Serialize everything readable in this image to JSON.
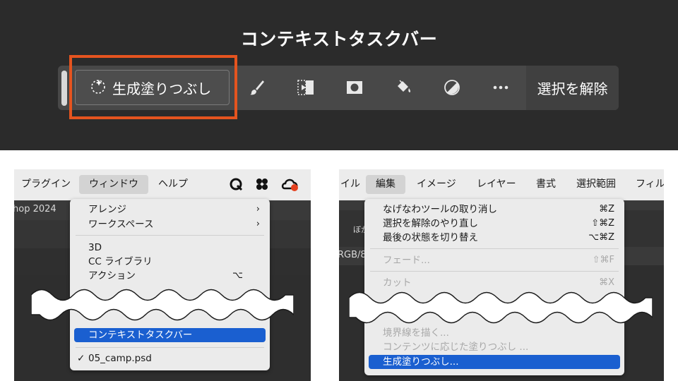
{
  "top": {
    "title": "コンテキストタスクバー",
    "generative_fill_label": "生成塗りつぶし",
    "deselect_label": "選択を解除",
    "tools": [
      "brush-icon",
      "transform-icon",
      "mask-icon",
      "fill-icon",
      "adjustment-icon",
      "more-icon"
    ],
    "highlight_color": "#e5541f"
  },
  "left": {
    "menubar": {
      "items": [
        "プラグイン",
        "ウィンドウ",
        "ヘルプ"
      ],
      "active": "ウィンドウ",
      "icons": [
        "search-q-icon",
        "clover-icon",
        "creative-cloud-icon"
      ]
    },
    "doc_title": "hop 2024",
    "menu": {
      "items_top": [
        {
          "label": "アレンジ",
          "shortcut": "›"
        },
        {
          "label": "ワークスペース",
          "shortcut": "›"
        },
        {
          "label": "3D",
          "shortcut": ""
        },
        {
          "label": "CC ライブラリ",
          "shortcut": ""
        },
        {
          "label": "アクション",
          "shortcut": "⌥"
        }
      ],
      "selected": "コンテキストタスクバー",
      "checked_item": "05_camp.psd",
      "check_mark": "✓"
    }
  },
  "right": {
    "menubar": {
      "items": [
        "イル",
        "編集",
        "イメージ",
        "レイヤー",
        "書式",
        "選択範囲",
        "フィル"
      ],
      "active": "編集"
    },
    "strip_texts": [
      "ぼか",
      "RGB/8"
    ],
    "menu": {
      "items_top": [
        {
          "label": "なげなわツールの取り消し",
          "shortcut": "⌘Z",
          "disabled": false
        },
        {
          "label": "選択を解除のやり直し",
          "shortcut": "⇧⌘Z",
          "disabled": false
        },
        {
          "label": "最後の状態を切り替え",
          "shortcut": "⌥⌘Z",
          "disabled": false
        },
        {
          "label": "フェード...",
          "shortcut": "⇧⌘F",
          "disabled": true
        },
        {
          "label": "カット",
          "shortcut": "⌘X",
          "disabled": true
        }
      ],
      "items_bottom": [
        {
          "label": "境界線を描く...",
          "disabled": true
        },
        {
          "label": "コンテンツに応じた塗りつぶし ...",
          "disabled": true
        }
      ],
      "selected": "生成塗りつぶし..."
    }
  }
}
